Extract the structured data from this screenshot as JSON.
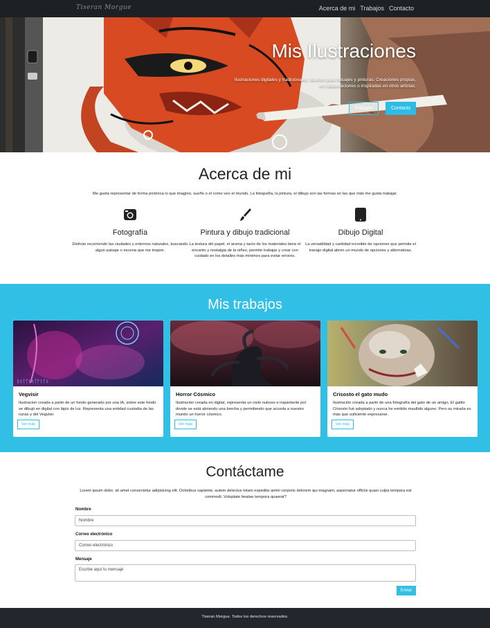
{
  "nav": {
    "brand": "Tiseran Morgue",
    "links": [
      "Acerca de mi",
      "Trabajos",
      "Contacto"
    ]
  },
  "hero": {
    "title": "Mis Ilustraciones",
    "subtitle": "Ilustraciones digitales y tradicionales, diseños para tatuajes y pinturas. Creaciones propias, en colaboraciones o inspiradas en otros artistas.",
    "btn_works": "Trabajos",
    "btn_contact": "Contacto"
  },
  "about": {
    "title": "Acerca de mi",
    "intro": "Me gusta representar de forma pictórica lo que imagino, sueño o el como veo el mundo. La fotografía, la pintura, el dibujo son las formas en las que más me gusta trabajar.",
    "features": [
      {
        "icon": "camera-icon",
        "title": "Fotografía",
        "text": "Disfruto recorriendo las ciudades y entornos naturales, buscando algun paisaje o escena que me inspire."
      },
      {
        "icon": "paintbrush-icon",
        "title": "Pintura y dibujo tradicional",
        "text": "La textura del papel, el aroma y tacto de los materiales tiene el encanto y nostalgia de la niñez, permite trabajar y crear con cuidado en los detalles más mínimos para evitar errores."
      },
      {
        "icon": "tablet-icon",
        "title": "Dibujo Digital",
        "text": "La versatilidad y cantidad increible de opciones que permite el tranajo digital abren un mundo de opciones y alternativas."
      }
    ]
  },
  "works": {
    "title": "Mis trabajos",
    "cards": [
      {
        "title": "Vegvisir",
        "text": "Ilustracion creada a partir de un fondo generado por una IA, sobre este fondo se dibujó en digital con lápiz de luz. Representa una entidad custodia de las runas y del Vegvisir.",
        "button": "Ver más"
      },
      {
        "title": "Horror Cósmico",
        "text": "Ilustración creada en digital, representa un cielo nuboso e inquietante por donde se está abriendo una brecha y permitiendo que acceda a nuestro mundo un horror cósmico.",
        "button": "Ver más"
      },
      {
        "title": "Crisosto el gato mudo",
        "text": "Ilustración creada a partir de una fotografía del gato de un amigo, El gatito Crisosto fué adoptado y nunca he emitido maullido alguno. Pero su mirada es más que suficiente expresarse.",
        "button": "Ver más"
      }
    ]
  },
  "contact": {
    "title": "Contáctame",
    "intro": "Lorem ipsum dolor, sit amet consectetur adipisicing elit. Doloribus sapiente, autem delectus totam expedita animi corporis dolorem qui magnam, aspernatur officiis quasi culpa tempora est commodi. Voluptate beatae tempora quaerat?",
    "name_label": "Nombre",
    "name_placeholder": "Nombre",
    "email_label": "Correo electrónico",
    "email_placeholder": "Correo electrónico",
    "message_label": "Mensaje",
    "message_placeholder": "Escribe aquí tu mensaje",
    "send": "Enviar"
  },
  "footer": {
    "text": "Tiseran Morgue. Todos los derechos reservados."
  },
  "colors": {
    "accent": "#31bfe6",
    "navbar": "#1e2124",
    "footer": "#23272b"
  }
}
